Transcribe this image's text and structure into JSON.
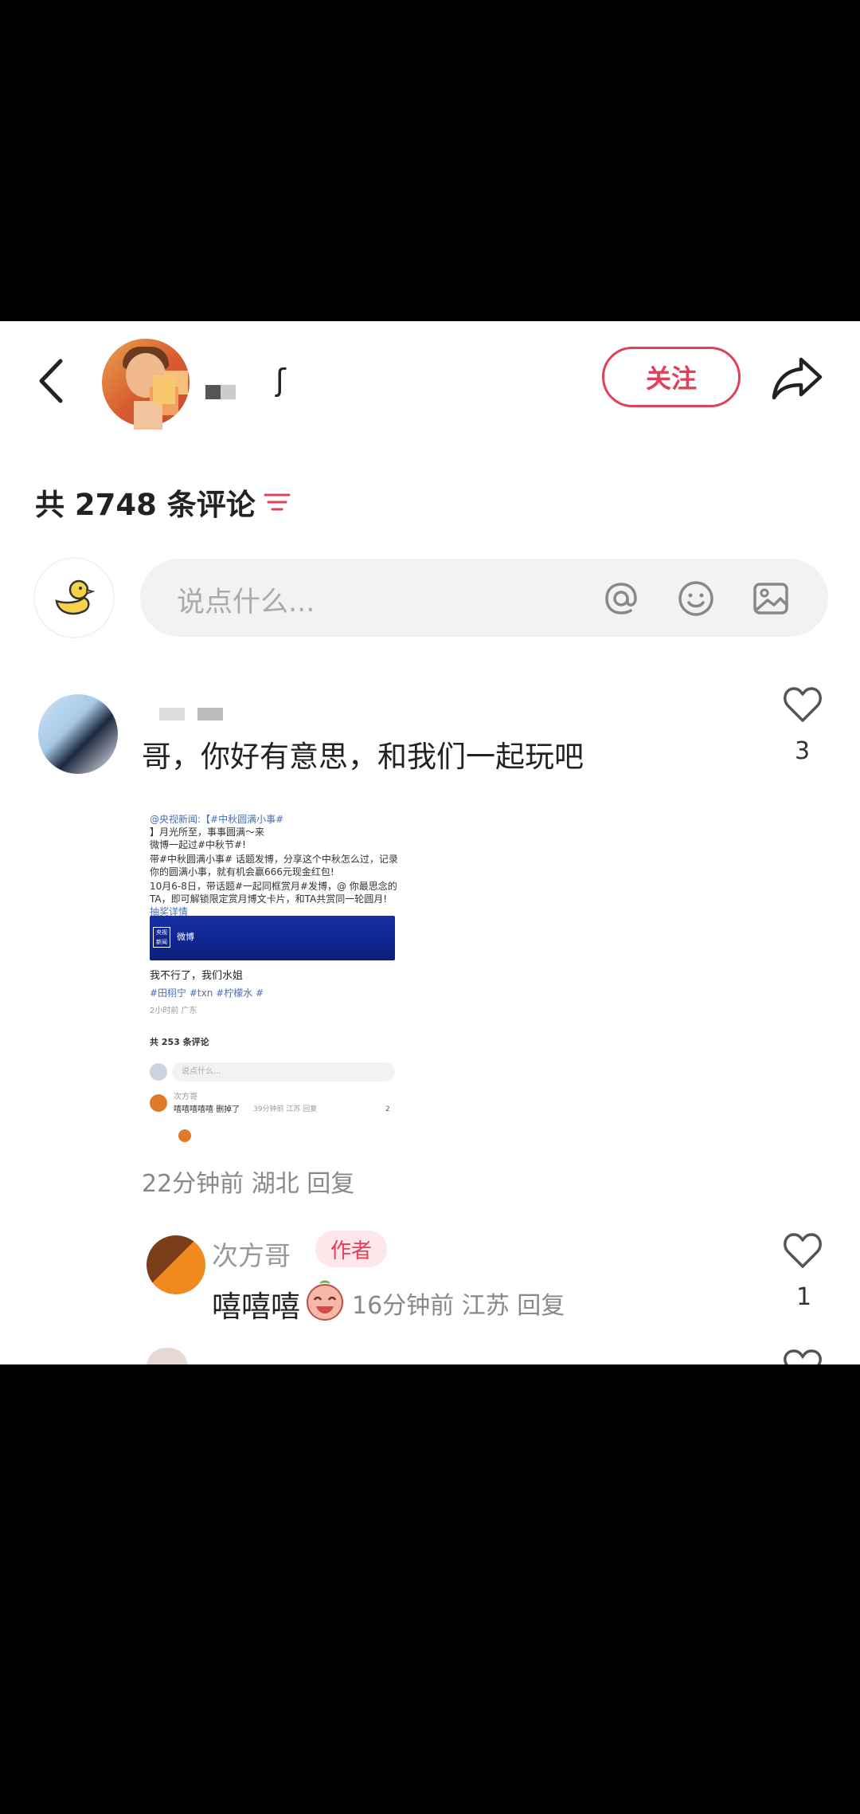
{
  "header": {
    "back_icon": "chevron-left-icon",
    "name_glyph": "ʃ",
    "follow_label": "关注",
    "share_icon": "share-arrow-icon"
  },
  "comments_header": {
    "count_label": "共 2748 条评论",
    "sort_icon": "filter-lines-icon"
  },
  "composer": {
    "placeholder": "说点什么...",
    "icons": [
      "at-icon",
      "emoji-icon",
      "image-icon"
    ]
  },
  "comment": {
    "text": "哥，你好有意思，和我们一起玩吧",
    "likes": "3",
    "meta": "22分钟前 湖北 回复",
    "screenshot": {
      "lines": [
        "@央视新闻:【#中秋圆满小事#",
        "】月光所至，事事圆满～来",
        "微博一起过#中秋节#!",
        "带#中秋圆满小事# 话题发博，分享这个中秋怎么过，记录",
        "你的圆满小事，就有机会赢666元现金红包!",
        "10月6-8日，带话题#一起同框赏月#发博，@ 你最思念的",
        "TA，即可解锁限定赏月博文卡片，和TA共赏同一轮圆月!",
        "抽奖详情"
      ],
      "banner_tag": "央视新闻",
      "banner_logo": "微博",
      "post_text": "我不行了，我们水姐",
      "post_tags": "#田栩宁 #txn #柠檬水 #",
      "post_meta": "2小时前 广东",
      "count": "共 253 条评论",
      "input_placeholder": "说点什么...",
      "reply_name": "次方哥",
      "reply_text": "嘻嘻嘻嘻嘻 删掉了",
      "reply_meta": "39分钟前 江苏 回复",
      "reply_likes": "2"
    }
  },
  "reply": {
    "name": "次方哥",
    "author_tag": "作者",
    "text": "嘻嘻嘻",
    "meta": "16分钟前 江苏 回复",
    "likes": "1"
  },
  "colors": {
    "accent": "#e0405a",
    "muted": "#888888",
    "input_bg": "#f2f2f3"
  }
}
